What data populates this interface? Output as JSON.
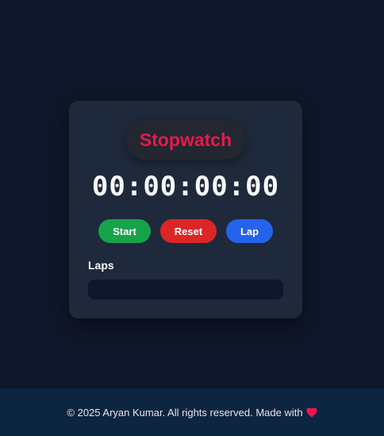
{
  "app": {
    "title": "Stopwatch",
    "time_display": "00:00:00:00"
  },
  "controls": {
    "start_label": "Start",
    "reset_label": "Reset",
    "lap_label": "Lap"
  },
  "laps": {
    "heading": "Laps",
    "items": []
  },
  "footer": {
    "text": "© 2025 Aryan Kumar. All rights reserved. Made with",
    "icon": "heart-icon"
  },
  "colors": {
    "background": "#0f172a",
    "card": "#1e293b",
    "title": "#e8194f",
    "start": "#16a34a",
    "reset": "#dc2626",
    "lap": "#2563eb",
    "footer": "#0c2540",
    "heart": "#e8194f"
  }
}
